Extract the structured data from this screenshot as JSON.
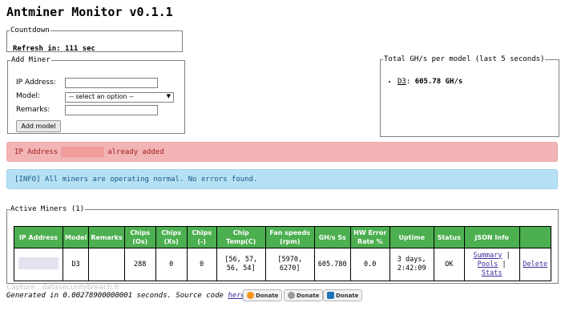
{
  "title": "Antminer Monitor v0.1.1",
  "countdown": {
    "legend": "Countdown",
    "label": "Refresh in:",
    "value": "111 sec"
  },
  "add_miner": {
    "legend": "Add Miner",
    "ip_label": "IP Address:",
    "ip_value": "",
    "model_label": "Model:",
    "model_selected": "-- select an option --",
    "remarks_label": "Remarks:",
    "remarks_value": "",
    "button_label": "Add model"
  },
  "totals": {
    "legend": "Total GH/s per model (last 5 seconds)",
    "items": [
      {
        "model": "D3",
        "separator": ":",
        "value": "605.78 GH/s"
      }
    ]
  },
  "alerts": {
    "danger_prefix": "IP Address",
    "danger_suffix": "already added",
    "info": "[INFO] All miners are operating normal. No errors found."
  },
  "active_miners": {
    "legend": "Active Miners (1)",
    "columns": [
      "IP Address",
      "Model",
      "Remarks",
      "Chips (Os)",
      "Chips (Xs)",
      "Chips (-)",
      "Chip Temp(C)",
      "Fan speeds (rpm)",
      "GH/s 5s",
      "HW Error Rate %",
      "Uptime",
      "Status",
      "JSON Info",
      ""
    ],
    "rows": [
      {
        "ip": "",
        "model": "D3",
        "remarks": "",
        "chips_os": "288",
        "chips_xs": "0",
        "chips_dash": "0",
        "chip_temp": "[56, 57, 56, 54]",
        "fan_speeds": "[5970, 6270]",
        "ghs_5s": "605.780",
        "hw_error": "0.0",
        "uptime": "3 days, 2:42:09",
        "status": "OK",
        "json_summary": "Summary",
        "json_pools": "Pools",
        "json_stats": "Stats",
        "json_sep": "|",
        "delete": "Delete"
      }
    ]
  },
  "watermark": "Capture : datasecuritybreach.fr",
  "footer": {
    "prefix": "Generated in 0.00278900000001 seconds. Source code",
    "link": "here",
    "suffix": ".",
    "donate_btc": "Donate",
    "donate_ltc": "Donate",
    "donate_dash": "Donate",
    "btc_color": "#f7931a",
    "ltc_color": "#9a9a9a",
    "dash_color": "#1c75bc"
  }
}
